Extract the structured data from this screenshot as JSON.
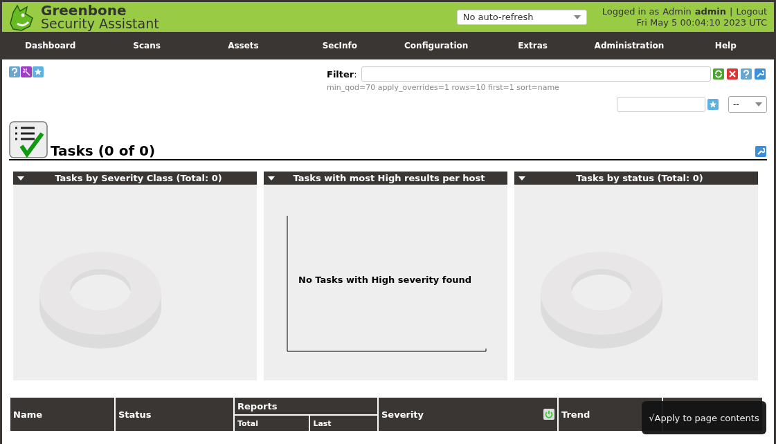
{
  "header": {
    "brand_line_1": "Greenbone",
    "brand_line_2": "Security Assistant",
    "refresh_select": "No auto-refresh",
    "login_label": "Logged in as",
    "role": "Admin",
    "user": "admin",
    "separator": "|",
    "logout": "Logout",
    "datetime": "Fri May 5 00:04:10 2023 UTC"
  },
  "nav": [
    {
      "label": "Dashboard"
    },
    {
      "label": "Scans"
    },
    {
      "label": "Assets"
    },
    {
      "label": "SecInfo"
    },
    {
      "label": "Configuration"
    },
    {
      "label": "Extras"
    },
    {
      "label": "Administration"
    },
    {
      "label": "Help"
    }
  ],
  "filter": {
    "label": "Filter",
    "colon": ":",
    "terms": "min_qod=70 apply_overrides=1 rows=10 first=1 sort=name",
    "select": "--"
  },
  "title": "Tasks (0 of 0)",
  "charts": [
    {
      "kind": "donut",
      "title": "Tasks by Severity Class (Total: 0)"
    },
    {
      "kind": "axes",
      "title": "Tasks with most High results per host",
      "message": "No Tasks with High severity found"
    },
    {
      "kind": "donut",
      "title": "Tasks by status (Total: 0)"
    }
  ],
  "table": {
    "columns": [
      {
        "label": "Name"
      },
      {
        "label": "Status"
      },
      {
        "label": "Reports",
        "children": [
          {
            "label": "Total"
          },
          {
            "label": "Last"
          }
        ]
      },
      {
        "label": "Severity",
        "overrides_toggle": true
      },
      {
        "label": "Trend"
      },
      {}
    ]
  },
  "tooltip": "√Apply to page contents"
}
